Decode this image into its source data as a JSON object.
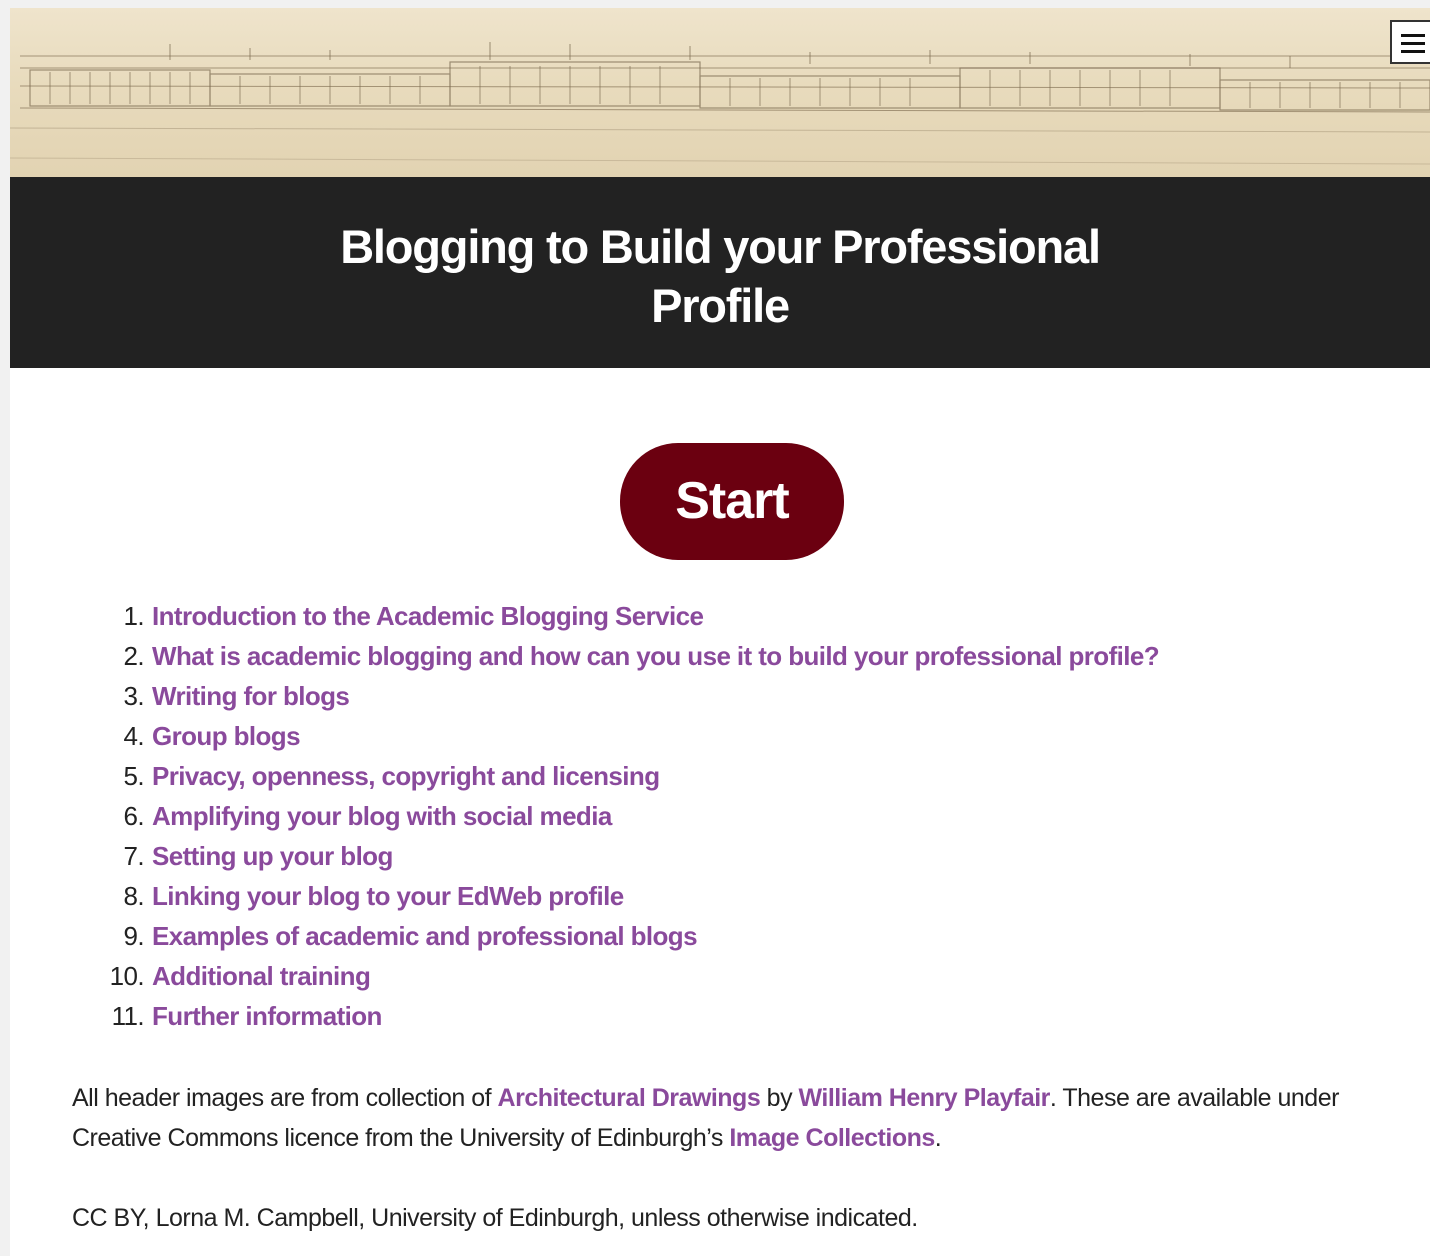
{
  "header": {
    "title_line1": "Blogging to Build your Professional",
    "title_line2": "Profile",
    "menu_icon": "hamburger-menu-icon",
    "banner_image": "architectural-drawing-banner"
  },
  "start_button": {
    "label": "Start",
    "color": "#6b0010"
  },
  "contents": [
    {
      "number": "1.",
      "label": "Introduction to the Academic Blogging Service"
    },
    {
      "number": "2.",
      "label": "What is academic blogging and how can you use it to build your professional profile?"
    },
    {
      "number": "3.",
      "label": "Writing for blogs"
    },
    {
      "number": "4.",
      "label": "Group blogs"
    },
    {
      "number": "5.",
      "label": "Privacy, openness, copyright and licensing"
    },
    {
      "number": "6.",
      "label": "Amplifying your blog with social media"
    },
    {
      "number": "7.",
      "label": "Setting up your blog"
    },
    {
      "number": "8.",
      "label": "Linking your blog to your EdWeb profile"
    },
    {
      "number": "9.",
      "label": "Examples of academic and professional blogs"
    },
    {
      "number": "10.",
      "label": "Additional training"
    },
    {
      "number": "11.",
      "label": "Further information"
    }
  ],
  "footer": {
    "credits_text1": "All header images are from collection of ",
    "credits_link1": "Architectural Drawings",
    "credits_text2": " by ",
    "credits_link2": "William Henry Playfair",
    "credits_text3": ".  These are available under Creative Commons licence from the University of Edinburgh’s ",
    "credits_link3": "Image Collections",
    "credits_text4": ".",
    "licence": "CC BY, Lorna M. Campbell, University of Edinburgh, unless otherwise indicated."
  },
  "colors": {
    "link": "#8a4a9c",
    "title_bar": "#222222",
    "banner": "#e8dbbd"
  }
}
